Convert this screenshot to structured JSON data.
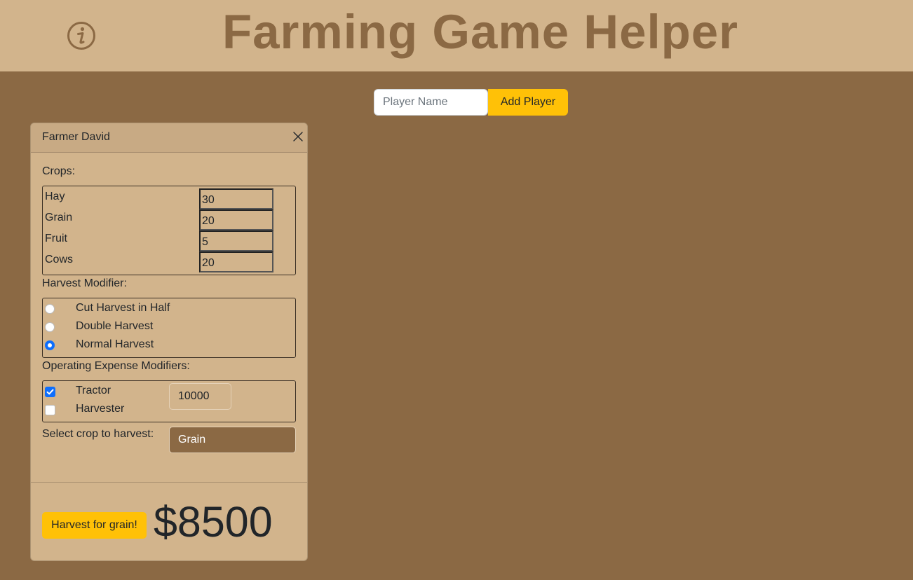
{
  "app": {
    "title": "Farming Game Helper",
    "info_icon": "info-icon"
  },
  "add_player": {
    "placeholder": "Player Name",
    "value": "",
    "button_label": "Add Player"
  },
  "player_card": {
    "name": "Farmer David",
    "close_icon": "close-icon",
    "crops_label": "Crops:",
    "crops": [
      {
        "name": "Hay",
        "value": "30"
      },
      {
        "name": "Grain",
        "value": "20"
      },
      {
        "name": "Fruit",
        "value": "5"
      },
      {
        "name": "Cows",
        "value": "20"
      }
    ],
    "harvest_modifier_label": "Harvest Modifier:",
    "harvest_modifiers": [
      {
        "label": "Cut Harvest in Half",
        "checked": false
      },
      {
        "label": "Double Harvest",
        "checked": false
      },
      {
        "label": "Normal Harvest",
        "checked": true
      }
    ],
    "expense_label": "Operating Expense Modifiers:",
    "expense_modifiers": [
      {
        "label": "Tractor",
        "checked": true
      },
      {
        "label": "Harvester",
        "checked": false
      }
    ],
    "expense_value": "10000",
    "select_label": "Select crop to harvest:",
    "selected_crop": "Grain",
    "harvest_button_label": "Harvest for grain!",
    "total": "$8500"
  },
  "colors": {
    "background": "#8b6944",
    "header_bg": "#d2b48c",
    "accent": "#ffc107",
    "checked": "#0d6efd"
  }
}
